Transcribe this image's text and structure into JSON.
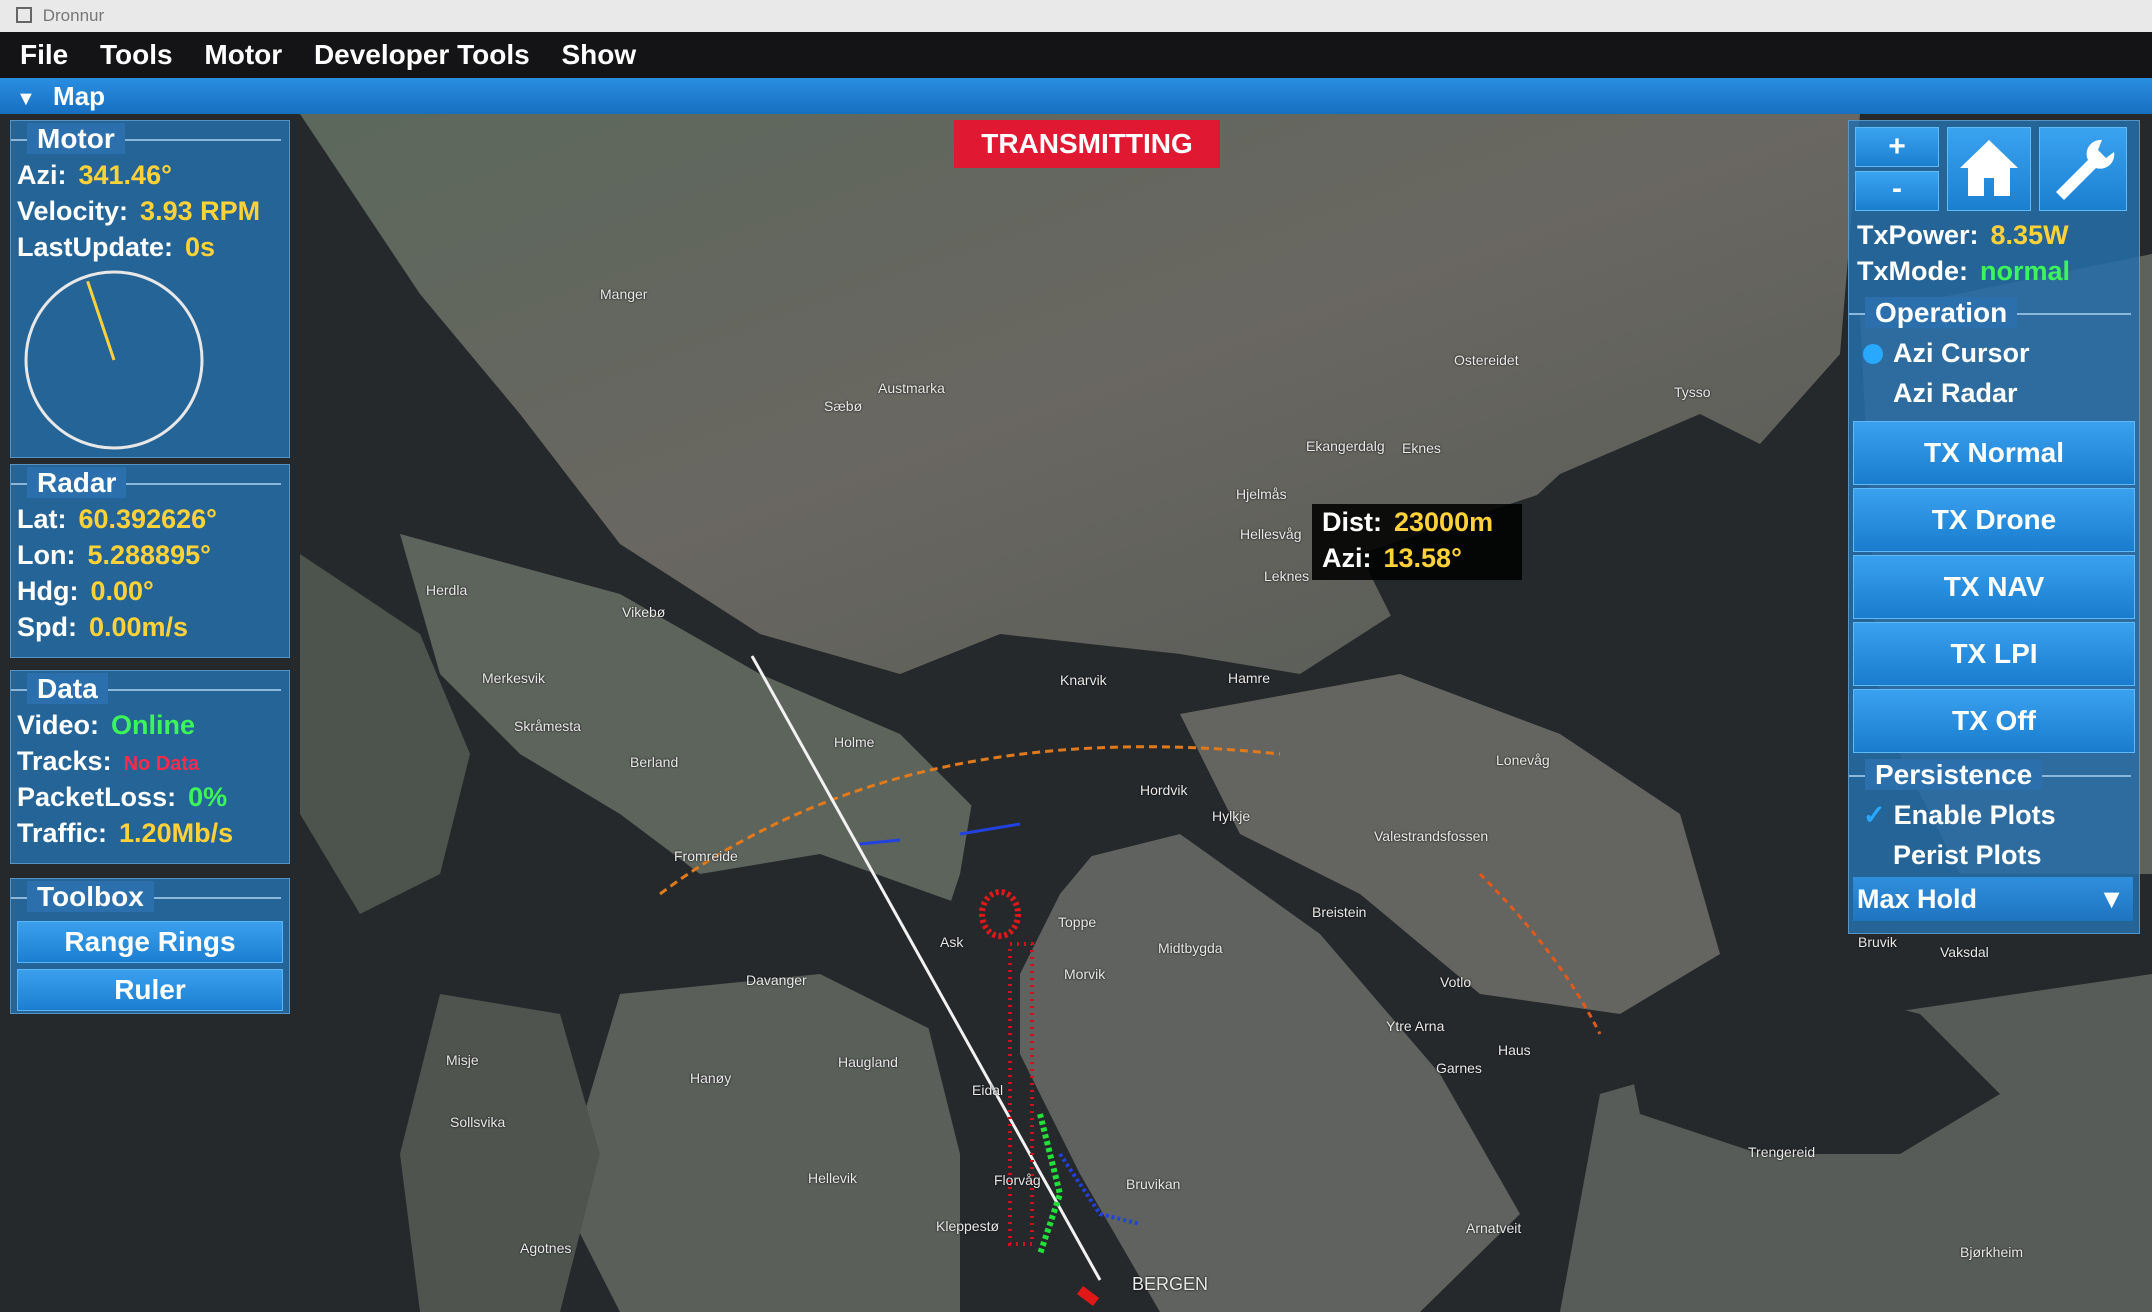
{
  "window": {
    "title": "Dronnur"
  },
  "menu": [
    "File",
    "Tools",
    "Motor",
    "Developer Tools",
    "Show"
  ],
  "map_bar": {
    "label": "Map"
  },
  "status_banner": "TRANSMITTING",
  "motor": {
    "title": "Motor",
    "azi_label": "Azi:",
    "azi_value": "341.46°",
    "velocity_label": "Velocity:",
    "velocity_value": "3.93 RPM",
    "lastupdate_label": "LastUpdate:",
    "lastupdate_value": "0s",
    "dial_angle_deg": 341.46
  },
  "radar": {
    "title": "Radar",
    "lat_label": "Lat:",
    "lat_value": "60.392626°",
    "lon_label": "Lon:",
    "lon_value": "5.288895°",
    "hdg_label": "Hdg:",
    "hdg_value": "0.00°",
    "spd_label": "Spd:",
    "spd_value": "0.00m/s"
  },
  "data": {
    "title": "Data",
    "video_label": "Video:",
    "video_value": "Online",
    "tracks_label": "Tracks:",
    "tracks_value": "No Data",
    "packetloss_label": "PacketLoss:",
    "packetloss_value": "0%",
    "traffic_label": "Traffic:",
    "traffic_value": "1.20Mb/s"
  },
  "toolbox": {
    "title": "Toolbox",
    "buttons": [
      "Range Rings",
      "Ruler"
    ]
  },
  "cursor_readout": {
    "dist_label": "Dist:",
    "dist_value": "23000m",
    "azi_label": "Azi:",
    "azi_value": "13.58°"
  },
  "right_panel": {
    "zoom_in": "+",
    "zoom_out": "-",
    "txpower_label": "TxPower:",
    "txpower_value": "8.35W",
    "txmode_label": "TxMode:",
    "txmode_value": "normal",
    "operation_title": "Operation",
    "op_options": [
      "Azi Cursor",
      "Azi Radar"
    ],
    "tx_buttons": [
      "TX Normal",
      "TX Drone",
      "TX NAV",
      "TX LPI",
      "TX Off"
    ],
    "persistence_title": "Persistence",
    "enable_plots": "Enable Plots",
    "perist_plots": "Perist Plots",
    "max_hold": "Max Hold"
  },
  "places": [
    "Manger",
    "Austmarka",
    "Sæbø",
    "Ostereidet",
    "Tysso",
    "Ekangerdalg",
    "Eknes",
    "Hjelmås",
    "Hellesvåg",
    "Leknes",
    "Herdla",
    "Vikebø",
    "Merkesvik",
    "Skråmesta",
    "Berland",
    "Knarvik",
    "Hamre",
    "Holme",
    "Lonevåg",
    "Hordvik",
    "Hylkje",
    "Valestrandsfossen",
    "Fromreide",
    "Toppe",
    "Breistein",
    "Ask",
    "Midtbygda",
    "Morvik",
    "Davanger",
    "Votlo",
    "Ytre Arna",
    "Haus",
    "Garnes",
    "Misje",
    "Haugland",
    "Hanøy",
    "Eidal",
    "Sollsvika",
    "Hellevik",
    "Florvåg",
    "Bruvikan",
    "Kleppestø",
    "Agotnes",
    "BERGEN",
    "Trengereid",
    "Arnatveit",
    "Bjørkheim",
    "Bruvik",
    "Vaksdal"
  ],
  "colors": {
    "accent": "#1f83d6",
    "value": "#ffd23a",
    "ok": "#3cf55a",
    "alert": "#e01832"
  }
}
